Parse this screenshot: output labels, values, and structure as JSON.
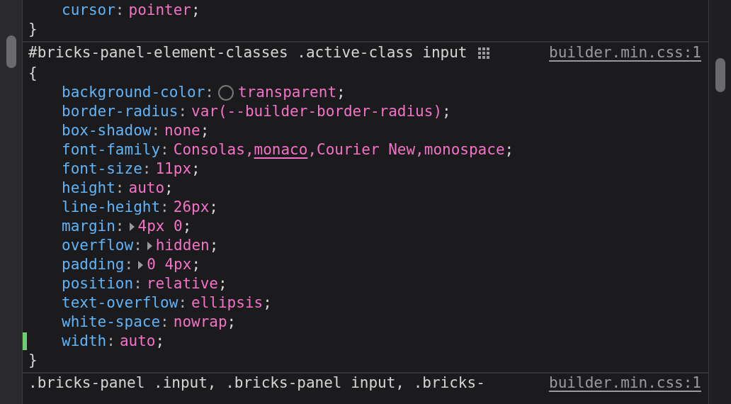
{
  "previous_rule": {
    "declarations": [
      {
        "property": "cursor:",
        "value": "pointer;",
        "modified": false
      }
    ],
    "closing": "}"
  },
  "rule": {
    "selector": "#bricks-panel-element-classes .active-class input",
    "source": "builder.min.css:1",
    "opening": "{",
    "declarations": [
      {
        "property": "background-color:",
        "value": "transparent;",
        "swatch": true,
        "modified": false
      },
      {
        "property": "border-radius:",
        "value": "var(--builder-border-radius);",
        "modified": false
      },
      {
        "property": "box-shadow:",
        "value": "none;",
        "modified": false
      },
      {
        "property": "font-family:",
        "segments": [
          {
            "text": "Consolas,",
            "underlined": false
          },
          {
            "text": "monaco",
            "underlined": true
          },
          {
            "text": ",Courier New,monospace;",
            "underlined": false
          }
        ],
        "modified": false
      },
      {
        "property": "font-size:",
        "value": "11px;",
        "modified": false
      },
      {
        "property": "height:",
        "value": "auto;",
        "modified": false
      },
      {
        "property": "line-height:",
        "value": "26px;",
        "modified": false
      },
      {
        "property": "margin:",
        "value": "4px 0;",
        "expandable": true,
        "modified": false
      },
      {
        "property": "overflow:",
        "value": "hidden;",
        "expandable": true,
        "modified": false
      },
      {
        "property": "padding:",
        "value": "0 4px;",
        "expandable": true,
        "modified": false
      },
      {
        "property": "position:",
        "value": "relative;",
        "modified": false
      },
      {
        "property": "text-overflow:",
        "value": "ellipsis;",
        "modified": false
      },
      {
        "property": "white-space:",
        "value": "nowrap;",
        "modified": false
      },
      {
        "property": "width:",
        "value": "auto;",
        "modified": true
      }
    ],
    "closing": "}"
  },
  "next_rule": {
    "selector": ".bricks-panel .input, .bricks-panel input, .bricks-",
    "source": "builder.min.css:1"
  }
}
